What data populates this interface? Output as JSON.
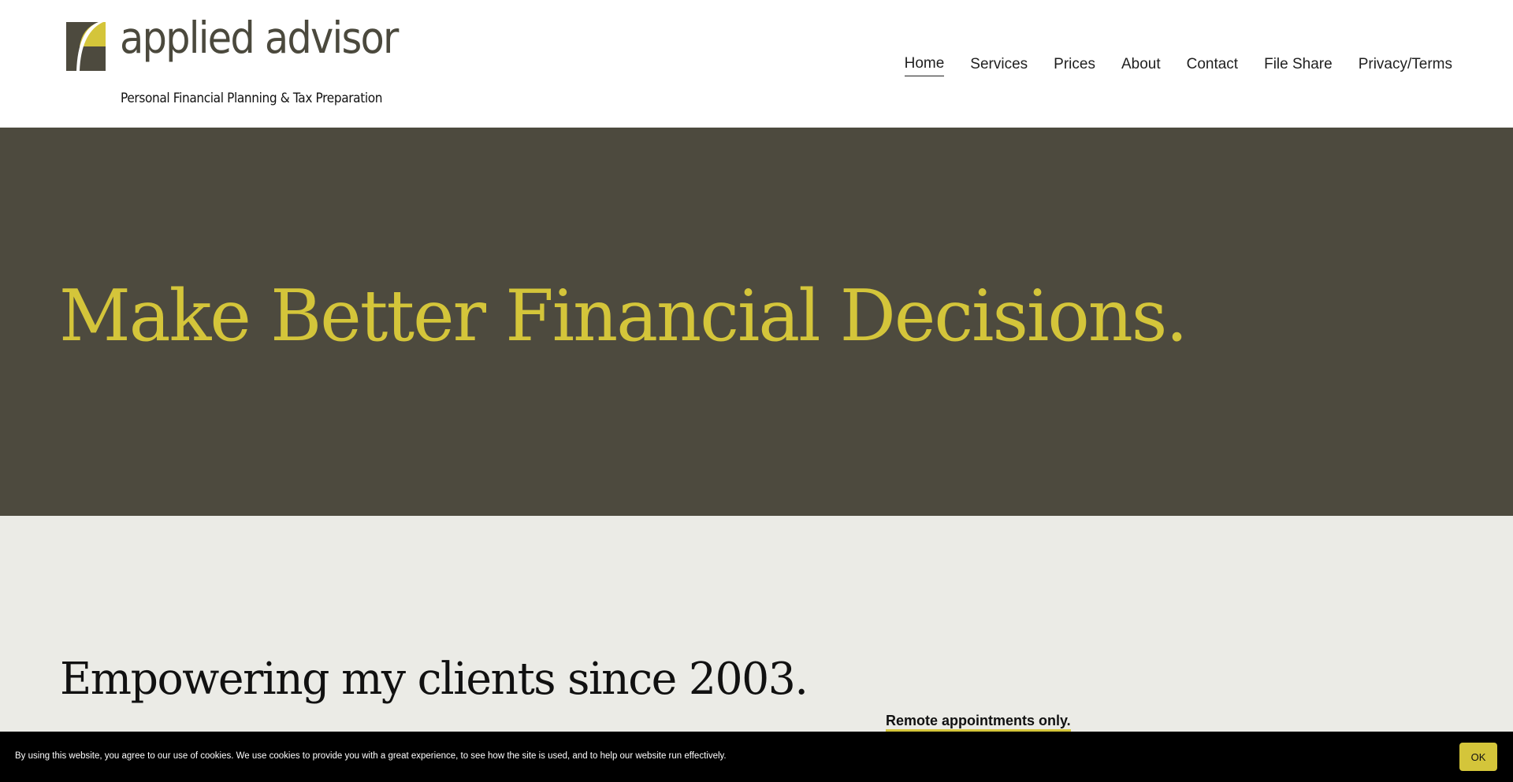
{
  "brand": {
    "name": "applied advisor",
    "tagline": "Personal Financial Planning & Tax Preparation",
    "colors": {
      "accent": "#d4c53a",
      "dark": "#4d4a3e",
      "light_bg": "#ebebe6"
    },
    "logo_icon": "arch-square-logo-icon"
  },
  "nav": {
    "items": [
      {
        "label": "Home",
        "active": true
      },
      {
        "label": "Services"
      },
      {
        "label": "Prices"
      },
      {
        "label": "About"
      },
      {
        "label": "Contact"
      },
      {
        "label": "File Share"
      },
      {
        "label": "Privacy/Terms"
      }
    ]
  },
  "hero": {
    "title": "Make Better Financial Decisions."
  },
  "intro": {
    "title": "Empowering my clients since 2003.",
    "note": "Remote appointments only."
  },
  "cookie": {
    "message": "By using this website, you agree to our use of cookies. We use cookies to provide you with a great experience, to see how the site is used, and to help our website run effectively.",
    "ok_label": "OK"
  }
}
